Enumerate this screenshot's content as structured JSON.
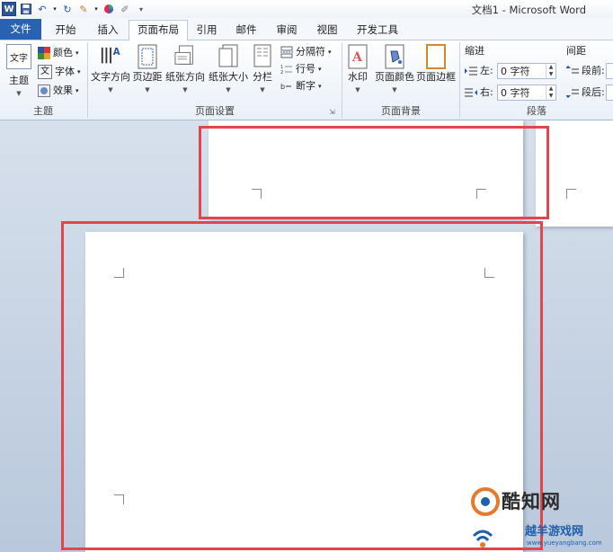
{
  "window": {
    "title": "文档1 - Microsoft Word"
  },
  "quick_access": {
    "word_icon_letter": "W"
  },
  "tabs": [
    "文件",
    "开始",
    "插入",
    "页面布局",
    "引用",
    "邮件",
    "审阅",
    "视图",
    "开发工具"
  ],
  "ribbon": {
    "theme_group": {
      "label": "主题",
      "theme_button": "主题",
      "theme_icon_text": "文字",
      "colors": "颜色",
      "fonts": "字体",
      "font_icon_text": "文",
      "effects": "效果"
    },
    "page_setup_group": {
      "label": "页面设置",
      "text_direction": "文字方向",
      "margins": "页边距",
      "orientation": "纸张方向",
      "size": "纸张大小",
      "columns": "分栏",
      "breaks": "分隔符",
      "line_numbers": "行号",
      "hyphenation": "断字",
      "text_direction_icon_text": "A"
    },
    "page_background_group": {
      "label": "页面背景",
      "watermark": "水印",
      "watermark_icon_text": "A",
      "page_color": "页面颜色",
      "page_borders": "页面边框"
    },
    "paragraph_group": {
      "label": "段落",
      "indent_header": "缩进",
      "spacing_header": "间距",
      "indent_left_label": "左:",
      "indent_left_value": "0 字符",
      "indent_right_label": "右:",
      "indent_right_value": "0 字符",
      "spacing_before_label": "段前:",
      "spacing_after_label": "段后:"
    }
  },
  "watermark_logo": {
    "name": "酷知网",
    "site_name": "越羊游戏网",
    "url": "www.yueyangbang.com",
    "colors": {
      "orange": "#e8792a",
      "blue": "#1e5fae"
    }
  },
  "colors": {
    "accent_blue": "#2a62b2",
    "highlight_red": "#e0464b",
    "doc_background": "#c8d4e4"
  }
}
